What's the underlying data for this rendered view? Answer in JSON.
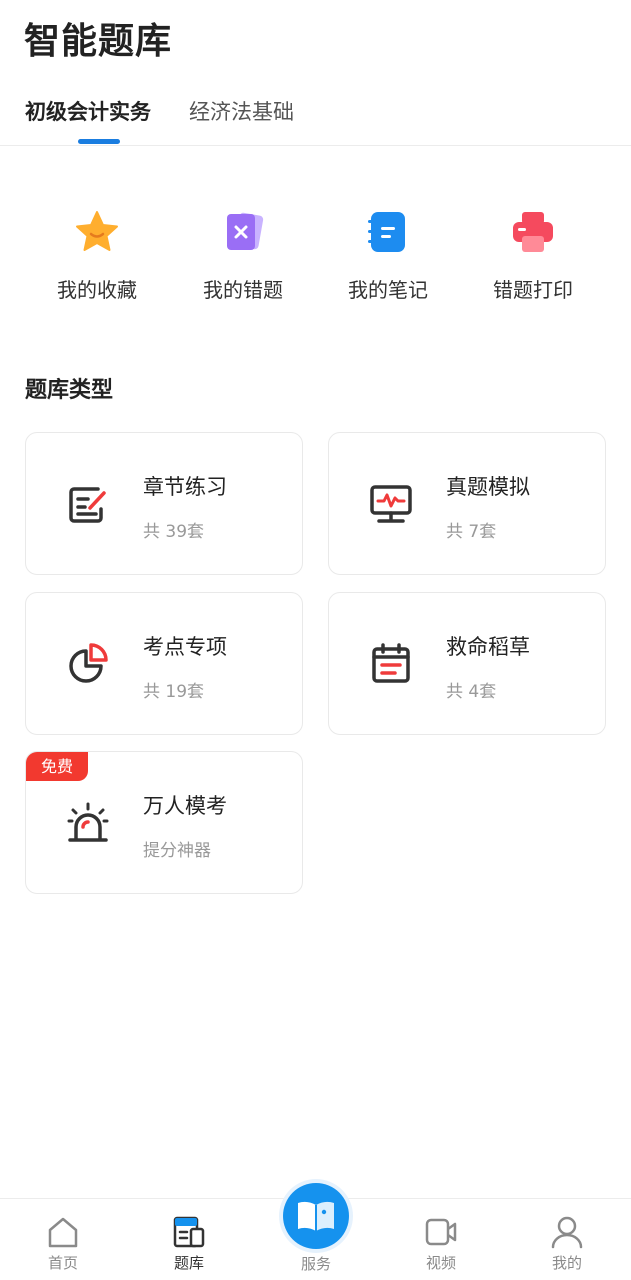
{
  "header": {
    "title": "智能题库"
  },
  "tabs": [
    {
      "label": "初级会计实务",
      "active": true
    },
    {
      "label": "经济法基础",
      "active": false
    }
  ],
  "quick_actions": [
    {
      "label": "我的收藏",
      "icon": "star-icon"
    },
    {
      "label": "我的错题",
      "icon": "wrong-questions-icon"
    },
    {
      "label": "我的笔记",
      "icon": "notebook-icon"
    },
    {
      "label": "错题打印",
      "icon": "printer-icon"
    }
  ],
  "section": {
    "title": "题库类型"
  },
  "cards": [
    {
      "title": "章节练习",
      "subtitle": "共 39套",
      "icon": "exercise-icon"
    },
    {
      "title": "真题模拟",
      "subtitle": "共 7套",
      "icon": "monitor-icon"
    },
    {
      "title": "考点专项",
      "subtitle": "共 19套",
      "icon": "pie-chart-icon"
    },
    {
      "title": "救命稻草",
      "subtitle": "共 4套",
      "icon": "calendar-icon"
    },
    {
      "title": "万人模考",
      "subtitle": "提分神器",
      "icon": "alarm-icon",
      "badge": "免费"
    }
  ],
  "tabbar": [
    {
      "label": "首页",
      "icon": "home-icon"
    },
    {
      "label": "题库",
      "icon": "question-bank-icon",
      "active": true
    },
    {
      "label": "服务",
      "icon": "book-icon"
    },
    {
      "label": "视频",
      "icon": "video-icon"
    },
    {
      "label": "我的",
      "icon": "user-icon"
    }
  ],
  "colors": {
    "accent": "#1a7de0",
    "badge": "#f2392f",
    "center_button": "#1592ee"
  }
}
